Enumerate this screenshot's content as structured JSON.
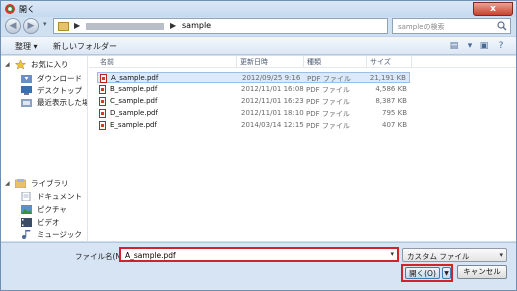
{
  "window": {
    "title": "開く",
    "close_label": "x"
  },
  "address": {
    "crumb_sep": "▶",
    "folder": "sample",
    "search_placeholder": "sampleの検索"
  },
  "toolbar": {
    "organize_label": "整理 ▾",
    "new_folder_label": "新しいフォルダー"
  },
  "sidebar": {
    "favorites": {
      "header": "お気に入り",
      "items": [
        "ダウンロード",
        "デスクトップ",
        "最近表示した場所"
      ]
    },
    "libraries": {
      "header": "ライブラリ",
      "items": [
        "ドキュメント",
        "ピクチャ",
        "ビデオ",
        "ミュージック"
      ]
    }
  },
  "columns": {
    "name": "名前",
    "date": "更新日時",
    "type": "種類",
    "size": "サイズ"
  },
  "files": [
    {
      "name": "A_sample.pdf",
      "date": "2012/09/25 9:16",
      "type": "PDF ファイル",
      "size": "21,191 KB",
      "selected": true
    },
    {
      "name": "B_sample.pdf",
      "date": "2012/11/01 16:08",
      "type": "PDF ファイル",
      "size": "4,586 KB",
      "selected": false
    },
    {
      "name": "C_sample.pdf",
      "date": "2012/11/01 16:23",
      "type": "PDF ファイル",
      "size": "8,387 KB",
      "selected": false
    },
    {
      "name": "D_sample.pdf",
      "date": "2012/11/01 18:10",
      "type": "PDF ファイル",
      "size": "795 KB",
      "selected": false
    },
    {
      "name": "E_sample.pdf",
      "date": "2014/03/14 12:15",
      "type": "PDF ファイル",
      "size": "407 KB",
      "selected": false
    }
  ],
  "footer": {
    "filename_label": "ファイル名(N):",
    "filename_value": "A_sample.pdf",
    "filter_value": "カスタム ファイル",
    "open_label": "開く(O)",
    "cancel_label": "キャンセル"
  }
}
